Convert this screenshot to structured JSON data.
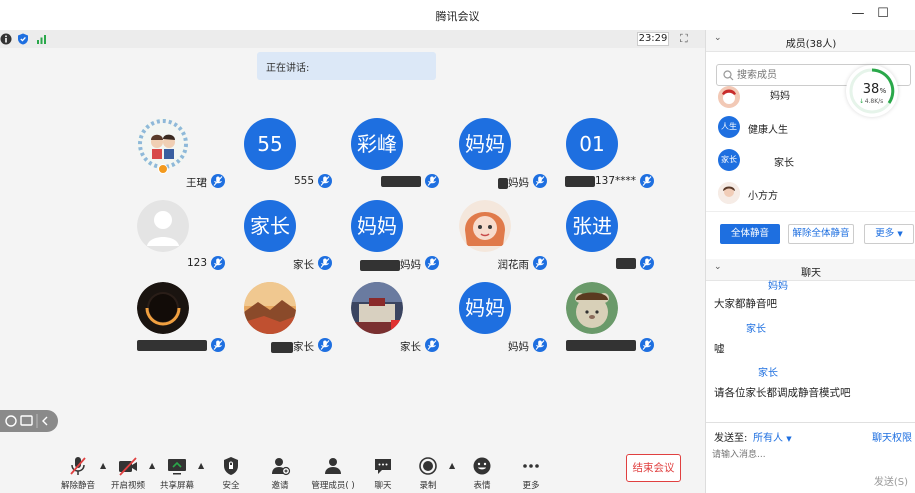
{
  "window": {
    "title": "腾讯会议",
    "minimize": "—",
    "maximize": "☐"
  },
  "status": {
    "time": "23:29"
  },
  "speaking": {
    "label": "正在讲话:"
  },
  "tiles": [
    {
      "avatar_text": "",
      "name": "王珺",
      "avatar_kind": "photo"
    },
    {
      "avatar_text": "55",
      "name": "555"
    },
    {
      "avatar_text": "彩峰",
      "name": "",
      "blur_w": 40
    },
    {
      "avatar_text": "妈妈",
      "name": "妈妈",
      "blur_w": 10
    },
    {
      "avatar_text": "01",
      "name": "137****",
      "blur_w": 30
    },
    {
      "avatar_text": "",
      "name": "123",
      "avatar_kind": "default"
    },
    {
      "avatar_text": "家长",
      "name": "家长"
    },
    {
      "avatar_text": "妈妈",
      "name": "妈妈",
      "blur_w": 40
    },
    {
      "avatar_text": "",
      "name": "润花雨",
      "avatar_kind": "girl"
    },
    {
      "avatar_text": "张进",
      "name": "",
      "blur_w": 20
    },
    {
      "avatar_text": "",
      "name": "",
      "avatar_kind": "eclipse",
      "blur_w": 70
    },
    {
      "avatar_text": "",
      "name": "家长",
      "avatar_kind": "sunset",
      "blur_w": 22
    },
    {
      "avatar_text": "",
      "name": "家长",
      "avatar_kind": "palace"
    },
    {
      "avatar_text": "妈妈",
      "name": "妈妈"
    },
    {
      "avatar_text": "",
      "name": "",
      "avatar_kind": "bear",
      "blur_w": 70
    }
  ],
  "toolbar": {
    "unmute": "解除静音",
    "video": "开启视频",
    "share": "共享屏幕",
    "security": "安全",
    "invite": "邀请",
    "members": "管理成员(  )",
    "chat": "聊天",
    "record": "录制",
    "emoji": "表情",
    "more": "更多",
    "end": "结束会议"
  },
  "members_panel": {
    "title": "成员(38人)",
    "search_placeholder": "搜索成员",
    "gauge_percent": "38",
    "gauge_unit": "%",
    "gauge_speed": "4.8K/s",
    "items": [
      {
        "badge": "",
        "name": "妈妈"
      },
      {
        "badge": "人生",
        "name": "健康人生"
      },
      {
        "badge": "家长",
        "name": "家长"
      },
      {
        "badge": "",
        "name": "小方方"
      }
    ],
    "mute_all": "全体静音",
    "unmute_all": "解除全体静音",
    "more": "更多"
  },
  "chat_panel": {
    "title": "聊天",
    "messages": [
      {
        "sender": "妈妈",
        "text": "大家都静音吧"
      },
      {
        "sender": "家长",
        "text": "嘘"
      },
      {
        "sender": "家长",
        "text": "请各位家长都调成静音模式吧"
      }
    ],
    "send_to_label": "发送至:",
    "send_to_value": "所有人",
    "permission": "聊天权限",
    "input_placeholder": "请输入消息...",
    "send": "发送(S)"
  },
  "colors": {
    "accent": "#1e6fe0",
    "danger": "#e04040"
  }
}
